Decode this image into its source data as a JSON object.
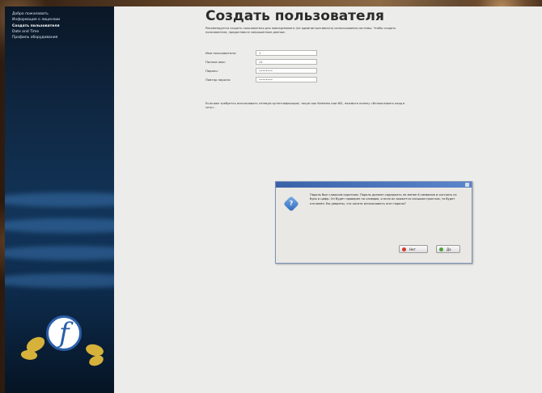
{
  "sidebar": {
    "items": [
      {
        "label": "Добро пожаловать"
      },
      {
        "label": "Информация о лицензии"
      },
      {
        "label": "Создать пользователя"
      },
      {
        "label": "Date and Time"
      },
      {
        "label": "Профиль оборудования"
      }
    ]
  },
  "main": {
    "title": "Создать пользователя",
    "intro": "Рекомендуется создать пользователя для повседневного (не административного) использования системы. Чтобы создать пользователя, предоставьте запрошенные данные.",
    "fields": [
      {
        "label": "Имя пользователя:",
        "value": "1"
      },
      {
        "label": "Полное имя:",
        "value": "11"
      },
      {
        "label": "Пароль:",
        "value": "••••••••"
      },
      {
        "label": "Повтор пароля:",
        "value": "••••••••"
      }
    ],
    "note": "Если вам требуется использовать сетевую аутентификацию, такую как Kerberos или NIS, нажмите кнопку «Использовать вход в сеть»."
  },
  "dialog": {
    "title": "",
    "message": "Пароль был слишком коротким. Пароль должен содержать не менее 6 символов и состоять из букв и цифр. Он будет проверен по словарю, и если он окажется слишком простым, то будет отклонён. Вы уверены, что хотите использовать этот пароль?",
    "buttons": [
      {
        "label": "Нет"
      },
      {
        "label": "Да"
      }
    ]
  }
}
